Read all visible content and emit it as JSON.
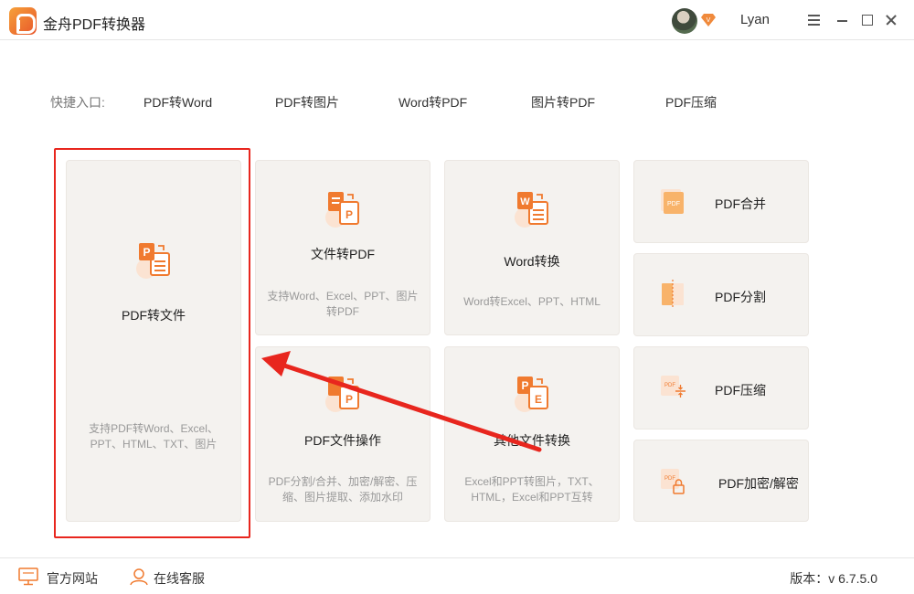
{
  "titlebar": {
    "app_title": "金舟PDF转换器",
    "user_name": "Lyan",
    "vip_badge": "V"
  },
  "quick_entry": {
    "label": "快捷入口:",
    "links": [
      "PDF转Word",
      "PDF转图片",
      "Word转PDF",
      "图片转PDF",
      "PDF压缩"
    ]
  },
  "cards": {
    "pdf_to_file": {
      "title": "PDF转文件",
      "desc": "支持PDF转Word、Excel、PPT、HTML、TXT、图片"
    },
    "file_to_pdf": {
      "title": "文件转PDF",
      "desc": "支持Word、Excel、PPT、图片转PDF"
    },
    "word_convert": {
      "title": "Word转换",
      "desc": "Word转Excel、PPT、HTML"
    },
    "pdf_operations": {
      "title": "PDF文件操作",
      "desc": "PDF分割/合并、加密/解密、压缩、图片提取、添加水印"
    },
    "other_convert": {
      "title": "其他文件转换",
      "desc": "Excel和PPT转图片，TXT、HTML，Excel和PPT互转"
    }
  },
  "small_cards": {
    "merge": {
      "title": "PDF合并",
      "icon_text": "PDF"
    },
    "split": {
      "title": "PDF分割"
    },
    "compress": {
      "title": "PDF压缩",
      "icon_text": "PDF"
    },
    "encrypt": {
      "title": "PDF加密/解密",
      "icon_text": "PDF"
    }
  },
  "icon_letters": {
    "p": "P",
    "w": "W",
    "e": "E"
  },
  "footer": {
    "official_site": "官方网站",
    "online_service": "在线客服",
    "version": "版本：v 6.7.5.0"
  },
  "colors": {
    "accent": "#f07a2f",
    "highlight": "#e8261e",
    "card_bg": "#f4f2ef"
  },
  "icons": [
    "app-logo",
    "vip-icon",
    "menu-icon",
    "minimize-icon",
    "maximize-icon",
    "close-icon",
    "monitor-icon",
    "user-service-icon"
  ]
}
